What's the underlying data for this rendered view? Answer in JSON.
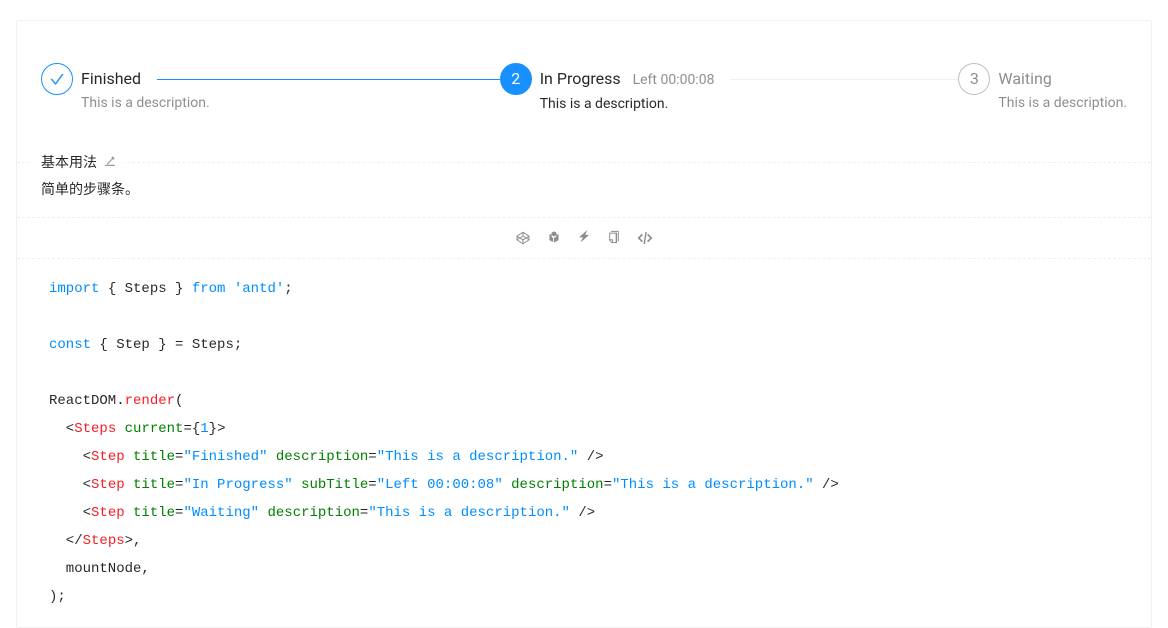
{
  "steps": [
    {
      "title": "Finished",
      "subtitle": "",
      "description": "This is a description.",
      "status": "finish",
      "iconNum": ""
    },
    {
      "title": "In Progress",
      "subtitle": "Left 00:00:08",
      "description": "This is a description.",
      "status": "process",
      "iconNum": "2"
    },
    {
      "title": "Waiting",
      "subtitle": "",
      "description": "This is a description.",
      "status": "wait",
      "iconNum": "3"
    }
  ],
  "meta": {
    "title": "基本用法",
    "description": "简单的步骤条。"
  },
  "actionIcons": {
    "codepen": "codepen-icon",
    "codesandbox": "codesandbox-icon",
    "stackblitz": "stackblitz-icon",
    "copy": "copy-icon",
    "expand": "code-icon"
  },
  "tokens": [
    [
      {
        "t": "import",
        "c": "kw"
      },
      {
        "t": " { Steps } ",
        "c": "p"
      },
      {
        "t": "from",
        "c": "kw"
      },
      {
        "t": " ",
        "c": "p"
      },
      {
        "t": "'antd'",
        "c": "str"
      },
      {
        "t": ";",
        "c": "p"
      }
    ],
    [],
    [
      {
        "t": "const",
        "c": "kw"
      },
      {
        "t": " { Step } = Steps;",
        "c": "p"
      }
    ],
    [],
    [
      {
        "t": "ReactDOM.",
        "c": "p"
      },
      {
        "t": "render",
        "c": "tag"
      },
      {
        "t": "(",
        "c": "p"
      }
    ],
    [
      {
        "t": "  <",
        "c": "p"
      },
      {
        "t": "Steps",
        "c": "tag"
      },
      {
        "t": " ",
        "c": "p"
      },
      {
        "t": "current",
        "c": "attr"
      },
      {
        "t": "=",
        "c": "p"
      },
      {
        "t": "{",
        "c": "p"
      },
      {
        "t": "1",
        "c": "num"
      },
      {
        "t": "}",
        "c": "p"
      },
      {
        "t": ">",
        "c": "p"
      }
    ],
    [
      {
        "t": "    <",
        "c": "p"
      },
      {
        "t": "Step",
        "c": "tag"
      },
      {
        "t": " ",
        "c": "p"
      },
      {
        "t": "title",
        "c": "attr"
      },
      {
        "t": "=",
        "c": "p"
      },
      {
        "t": "\"Finished\"",
        "c": "str"
      },
      {
        "t": " ",
        "c": "p"
      },
      {
        "t": "description",
        "c": "attr"
      },
      {
        "t": "=",
        "c": "p"
      },
      {
        "t": "\"This is a description.\"",
        "c": "str"
      },
      {
        "t": " />",
        "c": "p"
      }
    ],
    [
      {
        "t": "    <",
        "c": "p"
      },
      {
        "t": "Step",
        "c": "tag"
      },
      {
        "t": " ",
        "c": "p"
      },
      {
        "t": "title",
        "c": "attr"
      },
      {
        "t": "=",
        "c": "p"
      },
      {
        "t": "\"In Progress\"",
        "c": "str"
      },
      {
        "t": " ",
        "c": "p"
      },
      {
        "t": "subTitle",
        "c": "attr"
      },
      {
        "t": "=",
        "c": "p"
      },
      {
        "t": "\"Left 00:00:08\"",
        "c": "str"
      },
      {
        "t": " ",
        "c": "p"
      },
      {
        "t": "description",
        "c": "attr"
      },
      {
        "t": "=",
        "c": "p"
      },
      {
        "t": "\"This is a description.\"",
        "c": "str"
      },
      {
        "t": " />",
        "c": "p"
      }
    ],
    [
      {
        "t": "    <",
        "c": "p"
      },
      {
        "t": "Step",
        "c": "tag"
      },
      {
        "t": " ",
        "c": "p"
      },
      {
        "t": "title",
        "c": "attr"
      },
      {
        "t": "=",
        "c": "p"
      },
      {
        "t": "\"Waiting\"",
        "c": "str"
      },
      {
        "t": " ",
        "c": "p"
      },
      {
        "t": "description",
        "c": "attr"
      },
      {
        "t": "=",
        "c": "p"
      },
      {
        "t": "\"This is a description.\"",
        "c": "str"
      },
      {
        "t": " />",
        "c": "p"
      }
    ],
    [
      {
        "t": "  </",
        "c": "p"
      },
      {
        "t": "Steps",
        "c": "tag"
      },
      {
        "t": ">,",
        "c": "p"
      }
    ],
    [
      {
        "t": "  mountNode,",
        "c": "p"
      }
    ],
    [
      {
        "t": ");",
        "c": "p"
      }
    ]
  ]
}
